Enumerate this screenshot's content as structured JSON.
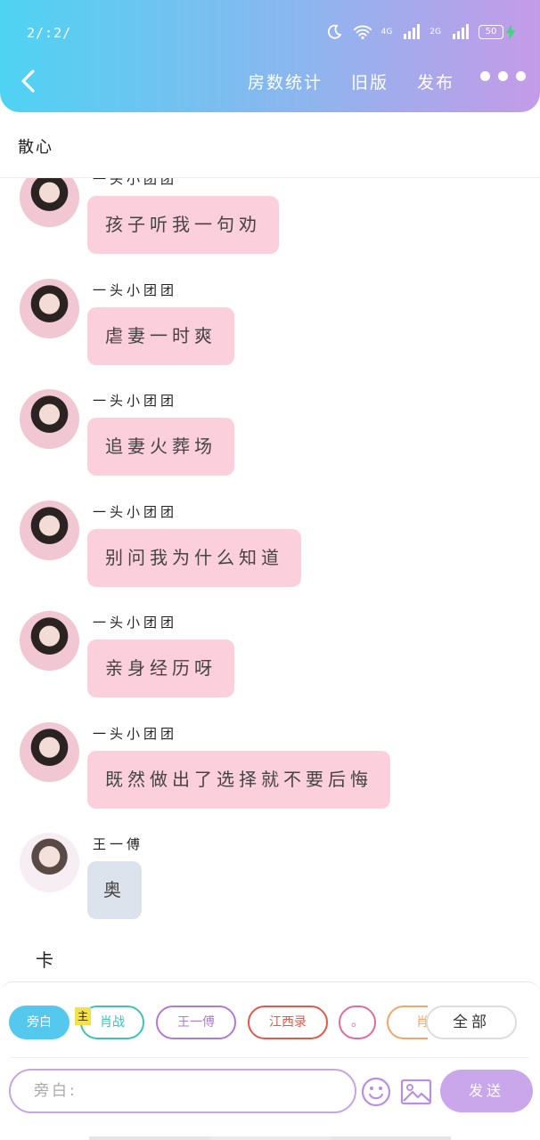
{
  "status_bar": {
    "time": "2/:2/",
    "network_4g": "4G",
    "network_2g": "2G",
    "battery": "50"
  },
  "header": {
    "actions": [
      "房数统计",
      "旧版",
      "发布"
    ]
  },
  "room": {
    "title": "散心"
  },
  "messages": [
    {
      "sender": "一头小团团",
      "text": "孩子听我一句劝"
    },
    {
      "sender": "一头小团团",
      "text": "虐妻一时爽"
    },
    {
      "sender": "一头小团团",
      "text": "追妻火葬场"
    },
    {
      "sender": "一头小团团",
      "text": "别问我为什么知道"
    },
    {
      "sender": "一头小团团",
      "text": "亲身经历呀"
    },
    {
      "sender": "一头小团团",
      "text": "既然做出了选择就不要后悔"
    },
    {
      "sender": "王一傅",
      "text": "奥"
    }
  ],
  "pending_text": "卡",
  "roles": {
    "owner_badge": "主",
    "chips": [
      {
        "label": "旁白",
        "color": "#55c8ee"
      },
      {
        "label": "肖战",
        "color": "#3cc3b4"
      },
      {
        "label": "王一傅",
        "color": "#b07ad6"
      },
      {
        "label": "江西录",
        "color": "#e05a4a"
      },
      {
        "label": "。",
        "color": "#e06ba0"
      },
      {
        "label": "肖",
        "color": "#f1a66a"
      }
    ],
    "all_label": "全部"
  },
  "composer": {
    "placeholder": "旁白:",
    "send_label": "发送"
  }
}
